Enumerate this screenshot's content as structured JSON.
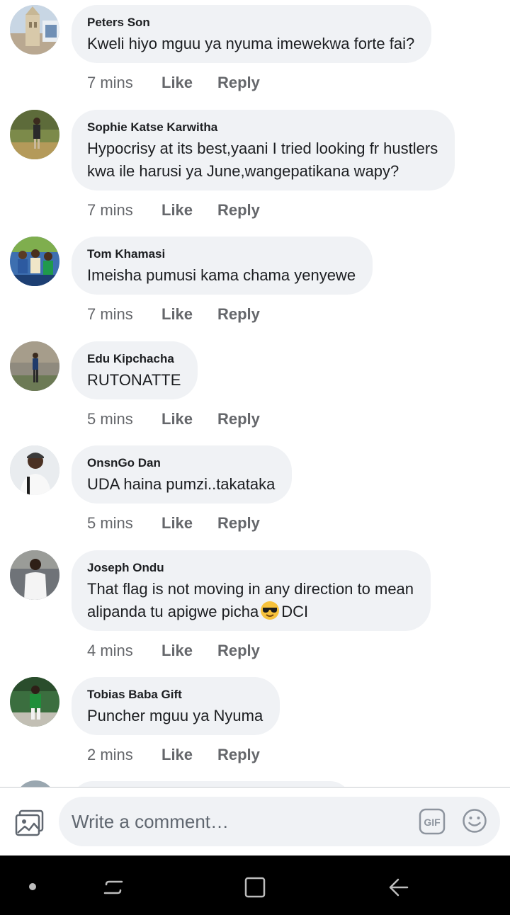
{
  "comments": [
    {
      "author": "Peters Son",
      "text": [
        "Kweli hiyo mguu ya nyuma imewekwa forte fai?"
      ],
      "time": "7 mins",
      "like": "Like",
      "reply": "Reply",
      "avatar_icon": "building-photo"
    },
    {
      "author": "Sophie Katse Karwitha",
      "text": [
        "Hypocrisy at its best,yaani I tried looking fr hustlers",
        "kwa ile harusi ya June,wangepatikana wapy?"
      ],
      "time": "7 mins",
      "like": "Like",
      "reply": "Reply",
      "avatar_icon": "person-field-photo"
    },
    {
      "author": "Tom Khamasi",
      "text": [
        "Imeisha pumusi kama chama yenyewe"
      ],
      "time": "7 mins",
      "like": "Like",
      "reply": "Reply",
      "avatar_icon": "group-photo"
    },
    {
      "author": "Edu Kipchacha",
      "text": [
        "RUTONATTE"
      ],
      "time": "5 mins",
      "like": "Like",
      "reply": "Reply",
      "avatar_icon": "person-standing-photo"
    },
    {
      "author": "OnsnGo Dan",
      "text": [
        "UDA haina pumzi..takataka"
      ],
      "time": "5 mins",
      "like": "Like",
      "reply": "Reply",
      "avatar_icon": "person-cap-photo"
    },
    {
      "author": "Joseph Ondu",
      "text": [
        "That flag is not moving in any direction to mean",
        "alipanda tu apigwe picha",
        "DCI"
      ],
      "time": "4 mins",
      "like": "Like",
      "reply": "Reply",
      "avatar_icon": "person-white-shirt-photo",
      "emoji_icon": "sunglasses-emoji"
    },
    {
      "author": "Tobias Baba Gift",
      "text": [
        "Puncher mguu ya Nyuma"
      ],
      "time": "2 mins",
      "like": "Like",
      "reply": "Reply",
      "avatar_icon": "person-green-jersey-photo"
    }
  ],
  "composer": {
    "placeholder": "Write a comment…",
    "photo_icon": "photo-icon",
    "gif_icon": "gif-icon",
    "emoji_icon": "emoji-icon"
  },
  "navbar": {
    "items": [
      "dot-icon",
      "recent-apps-icon",
      "home-icon",
      "back-icon"
    ]
  },
  "colors": {
    "bubble": "#f0f2f5",
    "meta_text": "#65676b",
    "nav_bg": "#000000"
  }
}
